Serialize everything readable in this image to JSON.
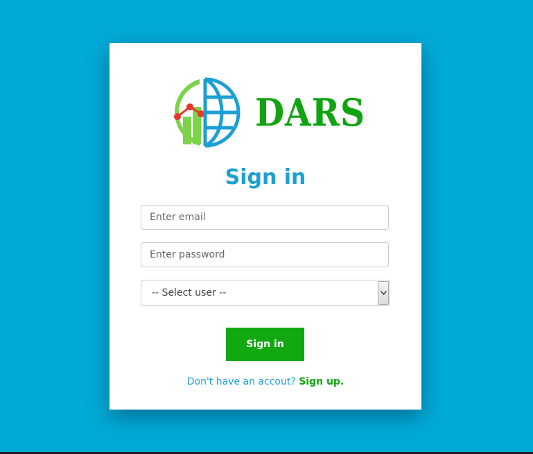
{
  "brand": {
    "name": "DARS",
    "logo_green": "#12a312",
    "logo_blue": "#1c9fd4",
    "logo_light_green": "#7ed34c",
    "logo_red": "#e8372a"
  },
  "page": {
    "background": "#00aad6",
    "title": "Sign in"
  },
  "form": {
    "email_placeholder": "Enter email",
    "password_placeholder": "Enter password",
    "user_select": {
      "selected": "-- Select user --"
    },
    "submit_label": "Sign in"
  },
  "signup": {
    "prompt": "Don't have an accout?",
    "link_label": "Sign up."
  }
}
